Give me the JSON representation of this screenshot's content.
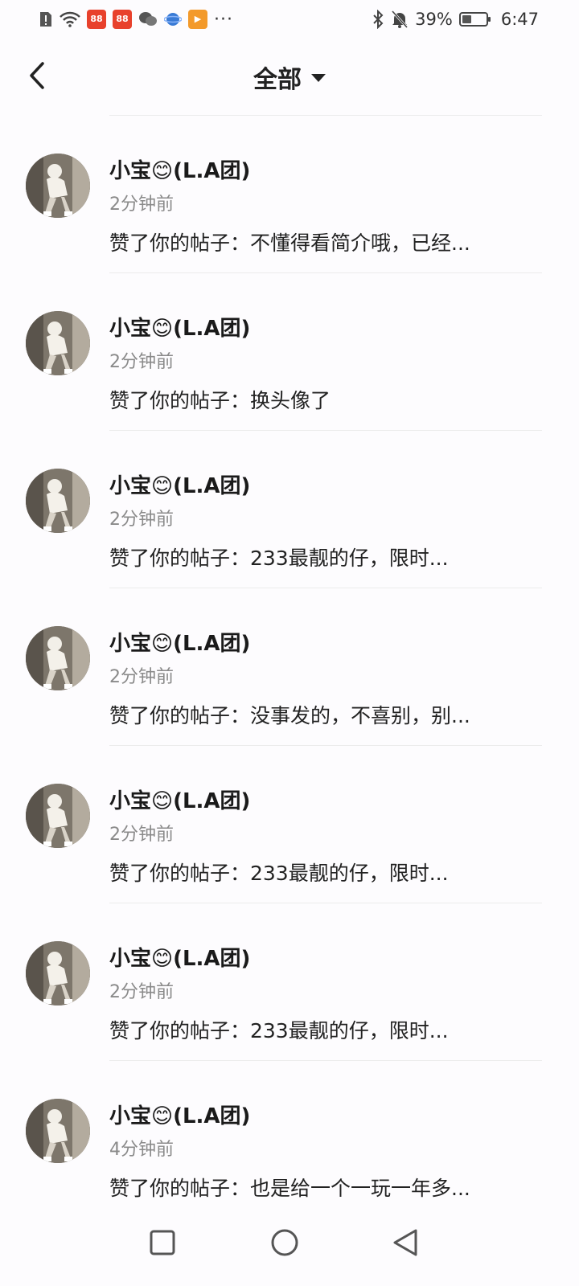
{
  "status_bar": {
    "battery": "39%",
    "time": "6:47",
    "battery_level": 0.39
  },
  "header": {
    "title": "全部"
  },
  "items": [
    {
      "name": "小宝😊(L.A团)",
      "time": "2分钟前",
      "text": "赞了你的帖子：不懂得看简介哦，已经..."
    },
    {
      "name": "小宝😊(L.A团)",
      "time": "2分钟前",
      "text": "赞了你的帖子：换头像了"
    },
    {
      "name": "小宝😊(L.A团)",
      "time": "2分钟前",
      "text": "赞了你的帖子：233最靓的仔，限时..."
    },
    {
      "name": "小宝😊(L.A团)",
      "time": "2分钟前",
      "text": "赞了你的帖子：没事发的，不喜别，别..."
    },
    {
      "name": "小宝😊(L.A团)",
      "time": "2分钟前",
      "text": "赞了你的帖子：233最靓的仔，限时..."
    },
    {
      "name": "小宝😊(L.A团)",
      "time": "2分钟前",
      "text": "赞了你的帖子：233最靓的仔，限时..."
    },
    {
      "name": "小宝😊(L.A团)",
      "time": "4分钟前",
      "text": "赞了你的帖子：也是给一个一玩一年多..."
    }
  ],
  "icons": {
    "back": "chevron-left-icon",
    "dropdown": "caret-down-icon",
    "nav_recent": "square-icon",
    "nav_home": "circle-icon",
    "nav_back": "triangle-back-icon"
  }
}
